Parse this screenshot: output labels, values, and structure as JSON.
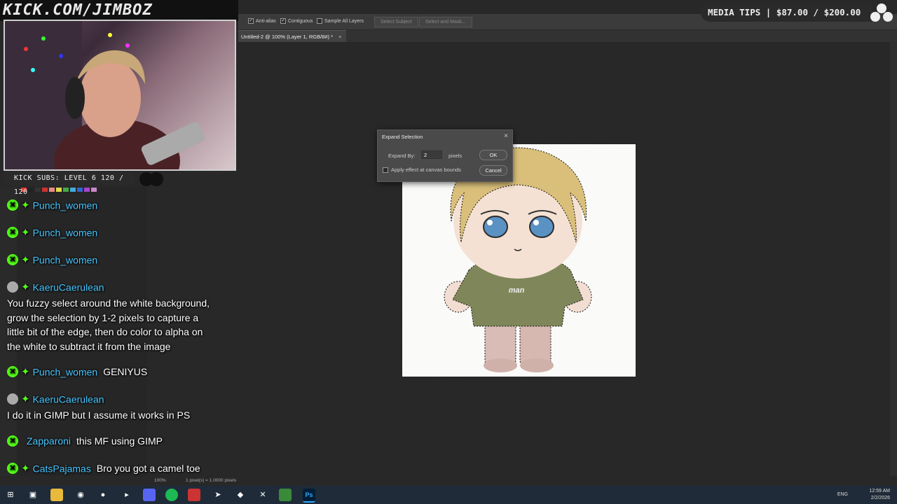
{
  "overlay": {
    "banner": "KICK.COM/JIMBOZ",
    "subs_goal": "KICK SUBS: LEVEL 6 120 / 120",
    "media_tips": "MEDIA TIPS | $87.00 / $200.00"
  },
  "options_bar": {
    "anti_alias": "Anti-alias",
    "contiguous": "Contiguous",
    "sample_all_layers": "Sample All Layers",
    "select_subject": "Select Subject",
    "select_and_mask": "Select and Mask..."
  },
  "document_tab": {
    "title": "Untitled-2 @ 100% (Layer 1, RGB/8#) *",
    "close": "×"
  },
  "image": {
    "shirt_text": "man"
  },
  "dialog": {
    "title": "Expand Selection",
    "close": "×",
    "expand_by_label": "Expand By:",
    "expand_by_value": "2",
    "unit": "pixels",
    "apply_bounds_label": "Apply effect at canvas bounds",
    "ok": "OK",
    "cancel": "Cancel"
  },
  "chat": [
    {
      "user": "Punch_women",
      "badges": [
        "kick",
        "star"
      ],
      "message": ""
    },
    {
      "user": "Punch_women",
      "badges": [
        "kick",
        "star"
      ],
      "message": ""
    },
    {
      "user": "Punch_women",
      "badges": [
        "kick",
        "star"
      ],
      "message": ""
    },
    {
      "user": "KaeruCaerulean",
      "badges": [
        "avatar",
        "star"
      ],
      "message": "You fuzzy select around the white background, grow the selection by 1-2 pixels to capture a little bit of the edge, then do color to alpha on the white to subtract it from the image"
    },
    {
      "user": "Punch_women",
      "badges": [
        "kick",
        "star"
      ],
      "message": "GENIYUS"
    },
    {
      "user": "KaeruCaerulean",
      "badges": [
        "avatar",
        "star"
      ],
      "message": "I do it in GIMP but I assume it works in PS"
    },
    {
      "user": "Zapparoni",
      "badges": [
        "kick"
      ],
      "message": "this MF using GIMP"
    },
    {
      "user": "CatsPajamas",
      "badges": [
        "kick",
        "star"
      ],
      "message": "Bro you got a camel toe"
    }
  ],
  "chat_lines": {
    "msg4_line1": "You fuzzy select around the white background,",
    "msg4_line2": "grow the selection by 1-2 pixels to capture a",
    "msg4_line3": "little bit of the edge, then do color to alpha on",
    "msg4_line4": "the white to subtract it from the image"
  },
  "status_bar": {
    "zoom": "100%",
    "info": "1 pixel(s) = 1.0000 pixels"
  },
  "taskbar": {
    "language": "ENG",
    "time": "12:59 AM",
    "date": "2/2/2026"
  },
  "colors": {
    "kick_green": "#53fc18",
    "username_blue": "#47c6ff",
    "ps_dialog_bg": "#4a4a4a",
    "ps_canvas_bg": "#282828"
  }
}
